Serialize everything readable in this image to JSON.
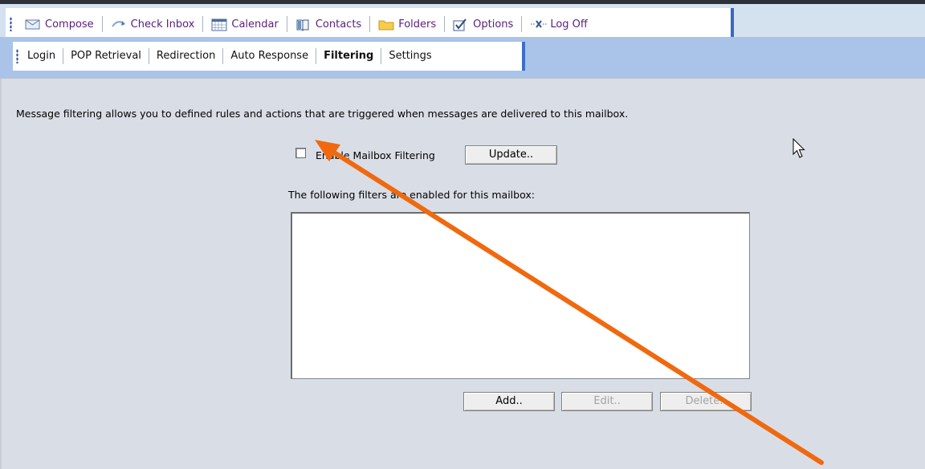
{
  "toolbar": {
    "items": [
      {
        "label": "Compose",
        "icon": "compose-icon"
      },
      {
        "label": "Check Inbox",
        "icon": "check-inbox-icon"
      },
      {
        "label": "Calendar",
        "icon": "calendar-icon"
      },
      {
        "label": "Contacts",
        "icon": "contacts-icon"
      },
      {
        "label": "Folders",
        "icon": "folder-icon"
      },
      {
        "label": "Options",
        "icon": "options-icon"
      },
      {
        "label": "Log Off",
        "icon": "log-off-icon"
      }
    ]
  },
  "tabs": {
    "items": [
      "Login",
      "POP Retrieval",
      "Redirection",
      "Auto Response",
      "Filtering",
      "Settings"
    ],
    "active": "Filtering"
  },
  "filtering": {
    "intro_text": "Message filtering allows you to defined rules and actions that are triggered when messages are delivered to this mailbox.",
    "enable_label": "Enable Mailbox Filtering",
    "enable_checked": false,
    "update_button": "Update..",
    "list_label": "The following filters are enabled for this mailbox:",
    "filters": [],
    "add_button": "Add..",
    "edit_button": "Edit..",
    "delete_button": "Delete.."
  },
  "colors": {
    "annotation_arrow": "#f0690f",
    "toolbar_text": "#5a1e7a",
    "accent_blue": "#3868c8"
  }
}
